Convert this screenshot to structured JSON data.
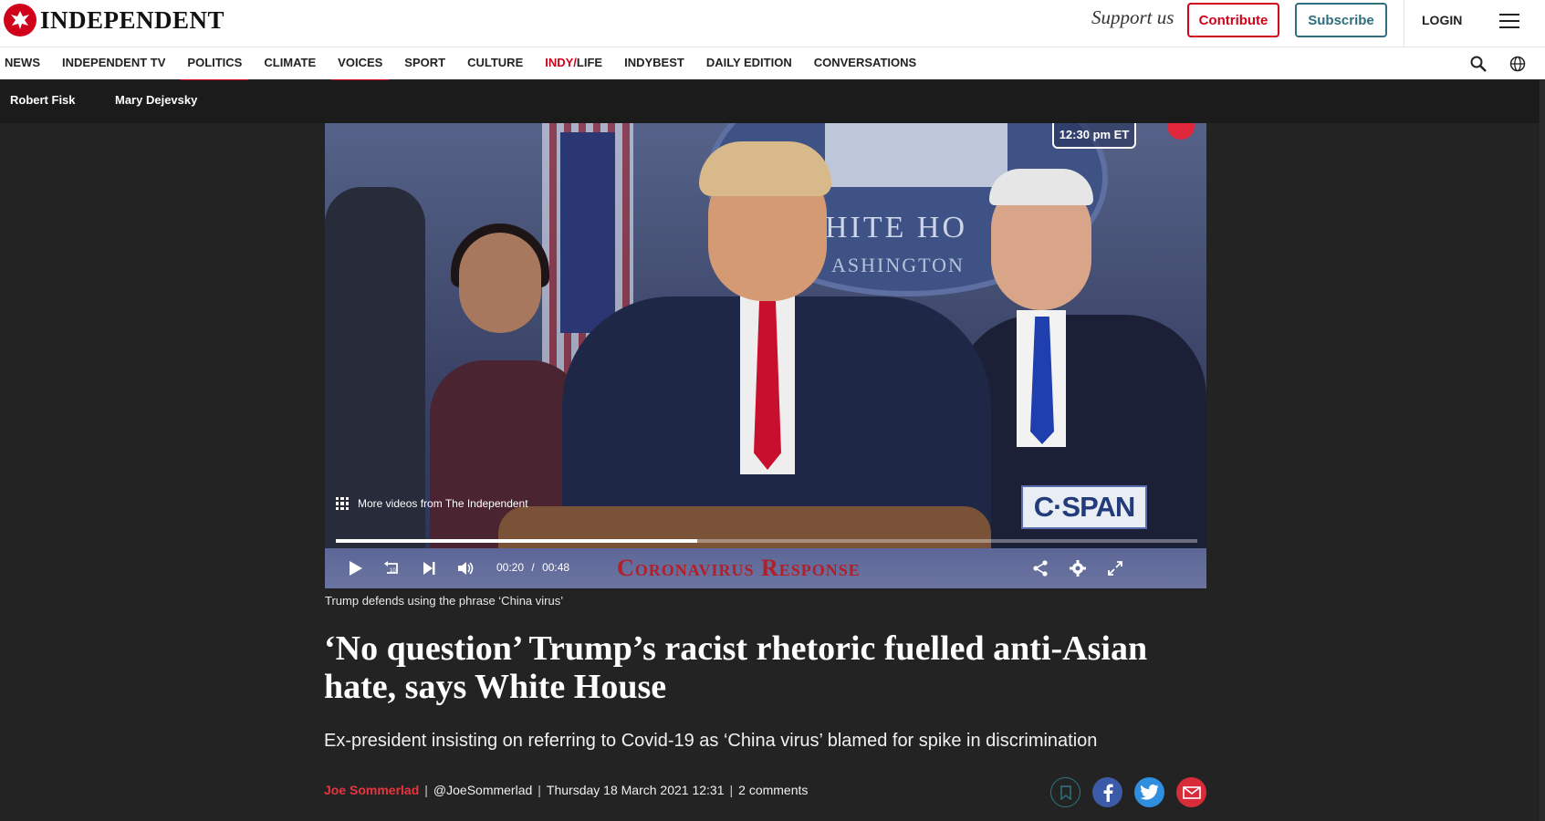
{
  "header": {
    "logo_text": "INDEPENDENT",
    "support_text": "Support us",
    "contribute_label": "Contribute",
    "subscribe_label": "Subscribe",
    "login_label": "LOGIN"
  },
  "nav": {
    "items": [
      {
        "label": "NEWS"
      },
      {
        "label": "INDEPENDENT TV"
      },
      {
        "label": "POLITICS"
      },
      {
        "label": "CLIMATE"
      },
      {
        "label": "VOICES"
      },
      {
        "label": "SPORT"
      },
      {
        "label": "CULTURE"
      },
      {
        "label_red": "INDY/",
        "label": "LIFE"
      },
      {
        "label": "INDYBEST"
      },
      {
        "label": "DAILY EDITION"
      },
      {
        "label": "CONVERSATIONS"
      }
    ]
  },
  "subnav": {
    "items": [
      {
        "label": "Robert Fisk"
      },
      {
        "label": "Mary Dejevsky"
      }
    ]
  },
  "video": {
    "live_label": "12:30 pm ET",
    "more_videos_label": "More videos from The Independent",
    "network_logo": "C·SPAN",
    "banner": "Coronavirus Response",
    "seal_line1": "HITE HO",
    "seal_line2": "ASHINGTON",
    "current_time": "00:20",
    "time_separator": "/",
    "duration": "00:48",
    "progress": 0.42
  },
  "article": {
    "caption": "Trump defends using the phrase ‘China virus’",
    "headline": "‘No question’ Trump’s racist rhetoric fuelled anti-Asian hate, says White House",
    "standfirst": "Ex-president insisting on referring to Covid-19 as ‘China virus’ blamed for spike in discrimination",
    "author": "Joe Sommerlad",
    "handle": "@JoeSommerlad",
    "date": "Thursday 18 March 2021 12:31",
    "comments": "2 comments"
  },
  "colors": {
    "brand_red": "#d0021b",
    "subscribe_teal": "#2e6f7d",
    "page_bg": "#232323"
  },
  "icons": [
    "eagle-logo-icon",
    "menu-icon",
    "search-icon",
    "globe-icon",
    "grid-icon",
    "play-icon",
    "rewind-10-icon",
    "skip-next-icon",
    "volume-icon",
    "share-icon",
    "settings-icon",
    "fullscreen-icon",
    "bookmark-icon",
    "facebook-icon",
    "twitter-icon",
    "email-icon"
  ]
}
